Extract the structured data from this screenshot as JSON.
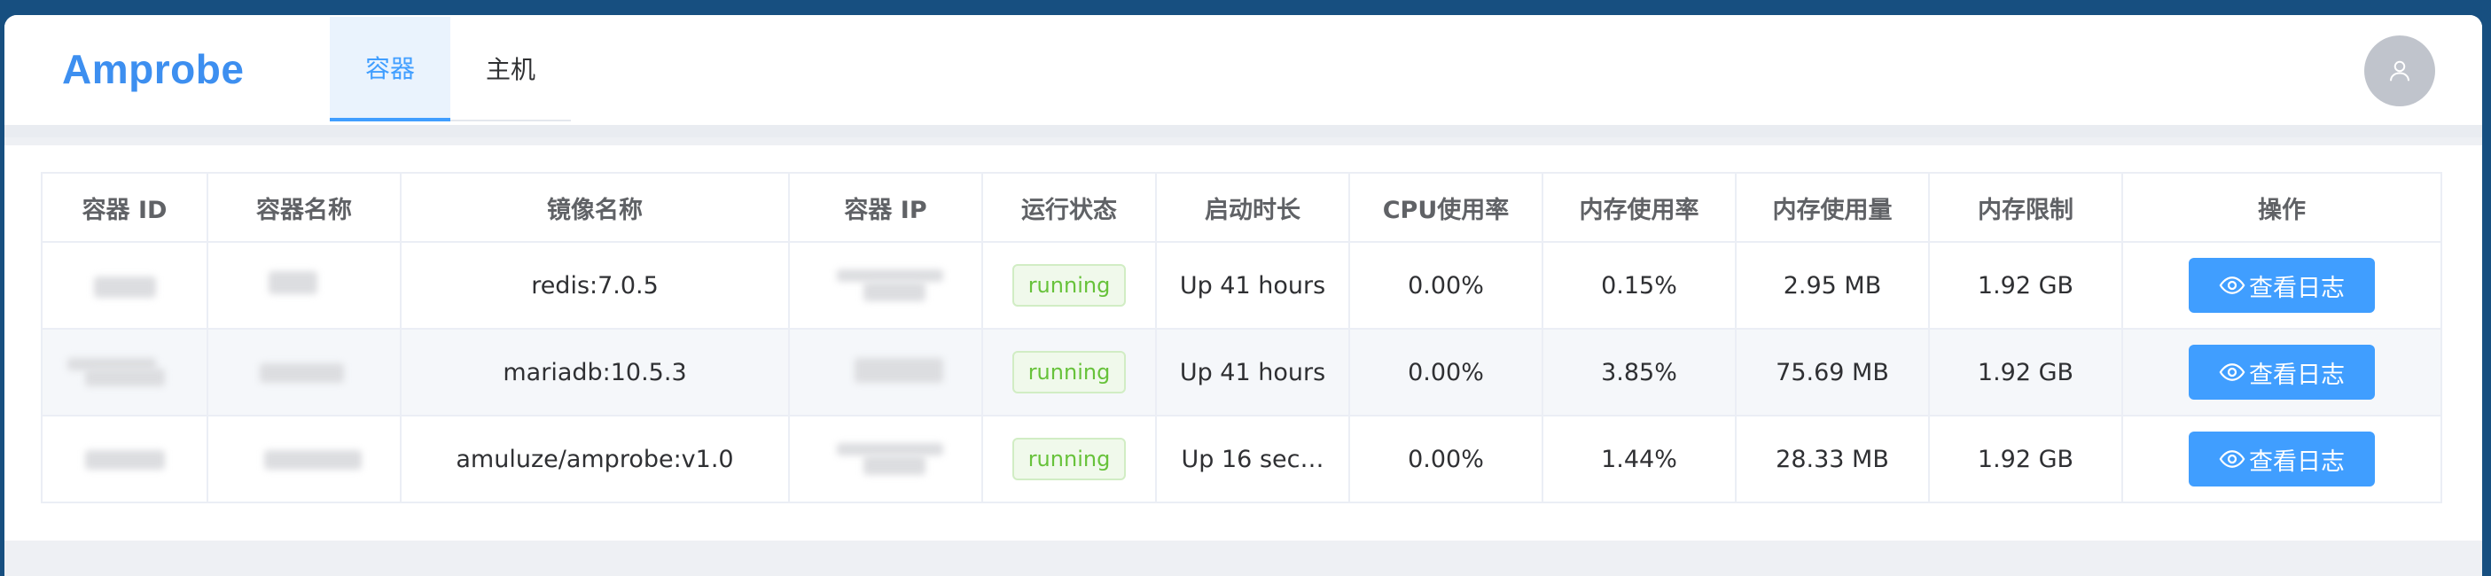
{
  "app": {
    "logo": "Amprobe"
  },
  "tabs": [
    {
      "label": "容器",
      "active": true
    },
    {
      "label": "主机",
      "active": false
    }
  ],
  "user": {
    "avatar_icon": "user-icon"
  },
  "table": {
    "headers": [
      "容器 ID",
      "容器名称",
      "镜像名称",
      "容器 IP",
      "运行状态",
      "启动时长",
      "CPU使用率",
      "内存使用率",
      "内存使用量",
      "内存限制",
      "操作"
    ],
    "rows": [
      {
        "image": "redis:7.0.5",
        "status": "running",
        "uptime": "Up 41 hours",
        "cpu": "0.00%",
        "mem_pct": "0.15%",
        "mem_used": "2.95 MB",
        "mem_limit": "1.92 GB",
        "action": "查看日志"
      },
      {
        "image": "mariadb:10.5.3",
        "status": "running",
        "uptime": "Up 41 hours",
        "cpu": "0.00%",
        "mem_pct": "3.85%",
        "mem_used": "75.69 MB",
        "mem_limit": "1.92 GB",
        "action": "查看日志"
      },
      {
        "image": "amuluze/amprobe:v1.0",
        "status": "running",
        "uptime": "Up 16 sec…",
        "cpu": "0.00%",
        "mem_pct": "1.44%",
        "mem_used": "28.33 MB",
        "mem_limit": "1.92 GB",
        "action": "查看日志"
      }
    ]
  },
  "colors": {
    "accent": "#409eff",
    "running": "#67c23a",
    "frame": "#174f80"
  }
}
